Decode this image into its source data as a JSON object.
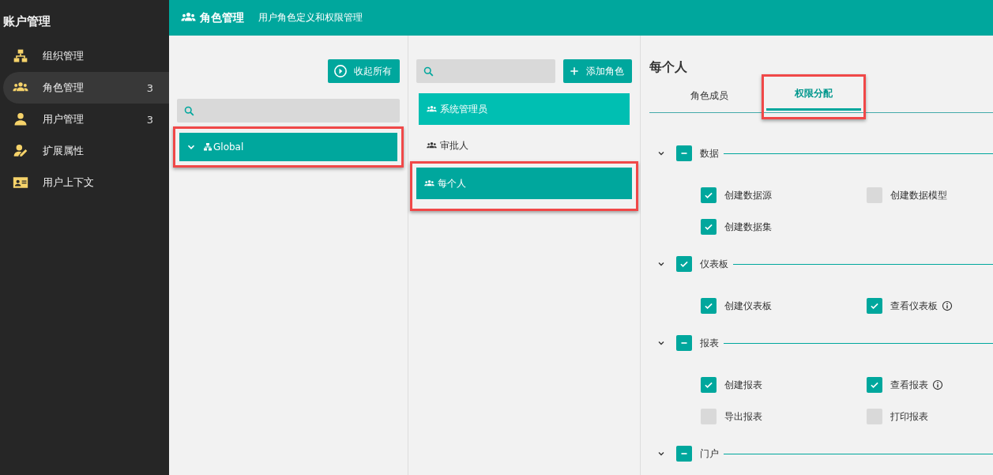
{
  "sidebar": {
    "title": "账户管理",
    "items": [
      {
        "label": "组织管理",
        "kind": "org",
        "selected": false
      },
      {
        "label": "角色管理",
        "kind": "group",
        "selected": true,
        "count": "3"
      },
      {
        "label": "用户管理",
        "kind": "user",
        "selected": false,
        "count": "3"
      },
      {
        "label": "扩展属性",
        "kind": "useredit",
        "selected": false
      },
      {
        "label": "用户上下文",
        "kind": "card",
        "selected": false
      }
    ]
  },
  "header": {
    "title": "角色管理",
    "subtitle": "用户角色定义和权限管理"
  },
  "org_panel": {
    "collapse_button": "收起所有",
    "tree": [
      {
        "label": "Global",
        "expanded": true,
        "selected": true,
        "highlighted": true
      }
    ]
  },
  "role_panel": {
    "add_button": "添加角色",
    "roles": [
      {
        "label": "系统管理员",
        "selected": false,
        "hovered": true,
        "highlighted": false
      },
      {
        "label": "审批人",
        "selected": false,
        "hovered": false,
        "highlighted": false
      },
      {
        "label": "每个人",
        "selected": true,
        "hovered": false,
        "highlighted": true
      }
    ]
  },
  "detail": {
    "title": "每个人",
    "tabs": [
      {
        "label": "角色成员",
        "selected": false,
        "highlighted": false
      },
      {
        "label": "权限分配",
        "selected": true,
        "highlighted": true
      }
    ],
    "groups": [
      {
        "label": "数据",
        "expanded": true,
        "partial": true,
        "items": [
          {
            "label": "创建数据源",
            "checked": true
          },
          {
            "label": "创建数据模型",
            "checked": false
          },
          {
            "label": "创建数据集",
            "checked": true
          }
        ]
      },
      {
        "label": "仪表板",
        "expanded": true,
        "checked": true,
        "items": [
          {
            "label": "创建仪表板",
            "checked": true
          },
          {
            "label": "查看仪表板",
            "checked": true,
            "info": true
          }
        ]
      },
      {
        "label": "报表",
        "expanded": true,
        "partial": true,
        "items": [
          {
            "label": "创建报表",
            "checked": true
          },
          {
            "label": "查看报表",
            "checked": true,
            "info": true
          },
          {
            "label": "导出报表",
            "checked": false
          },
          {
            "label": "打印报表",
            "checked": false
          }
        ]
      },
      {
        "label": "门户",
        "expanded": true,
        "partial": true
      }
    ]
  }
}
